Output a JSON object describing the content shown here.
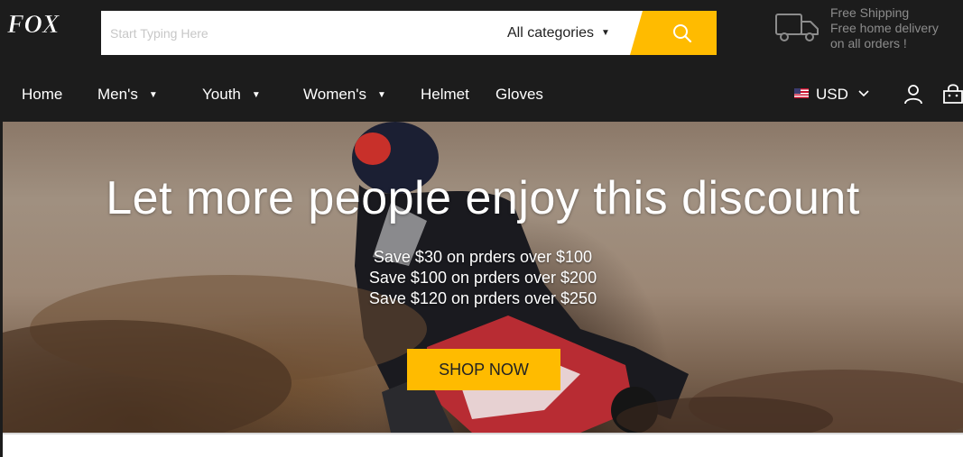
{
  "brand": {
    "logo_text": "FOX"
  },
  "search": {
    "placeholder": "Start Typing Here",
    "category_label": "All categories"
  },
  "shipping": {
    "line1": "Free Shipping",
    "line2": "Free home delivery",
    "line3": "on all orders !"
  },
  "nav": {
    "items": [
      {
        "label": "Home",
        "has_dropdown": false
      },
      {
        "label": "Men's",
        "has_dropdown": true
      },
      {
        "label": "Youth",
        "has_dropdown": true
      },
      {
        "label": "Women's",
        "has_dropdown": true
      },
      {
        "label": "Helmet",
        "has_dropdown": false
      },
      {
        "label": "Gloves",
        "has_dropdown": false
      }
    ],
    "currency": "USD"
  },
  "hero": {
    "title": "Let more people enjoy this discount",
    "lines": [
      "Save $30 on prders over $100",
      "Save $100 on prders over $200",
      "Save $120 on prders over $250"
    ],
    "cta": "SHOP NOW"
  },
  "colors": {
    "accent": "#ffbb00",
    "header_bg": "#1c1c1c"
  },
  "icons": [
    "fox-logo",
    "search-icon",
    "truck-icon",
    "user-icon",
    "cart-icon",
    "us-flag-icon"
  ]
}
